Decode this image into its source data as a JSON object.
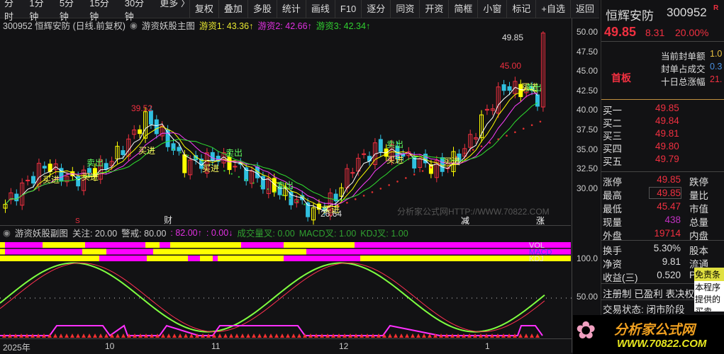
{
  "toolbar": {
    "left": [
      "分时",
      "1分钟",
      "5分钟",
      "15分钟",
      "30分钟",
      "更多 〉"
    ],
    "right": [
      "复权",
      "叠加",
      "多股",
      "统计",
      "画线",
      "F10",
      "逐分",
      "同资",
      "开资",
      "简框",
      "小窗",
      "标记",
      "+自选",
      "返回"
    ]
  },
  "infobar": {
    "code_name": "300952 恒辉安防 (日线.前复权)",
    "indicator": "游资妖股主图",
    "v1": "游资1: 43.36↑",
    "v2": "游资2: 42.66↑",
    "v3": "游资3: 42.34↑"
  },
  "main_labels": {
    "high1": "39.52",
    "high2": "45.00",
    "last": "49.85",
    "low": "26.64",
    "watermark": "分析家公式网HTTP://WWW.70822.COM",
    "buy": "买进",
    "sell": "卖出",
    "tag_s": "S",
    "tag_cai": "财",
    "tag_jian": "减",
    "tag_zhang": "涨"
  },
  "price_axis": [
    "50.00",
    "47.50",
    "45.00",
    "42.50",
    "40.00",
    "37.50",
    "35.00",
    "32.50",
    "30.00"
  ],
  "sub": {
    "title": "游资妖股副图",
    "focus": "关注: 20.00",
    "warn": "警戒: 80.00",
    "v1": ": 82.00↑",
    "v2": ": 0.00↓",
    "vol": "成交量叉: 0.00",
    "macd": "MACD叉: 1.00",
    "kdj": "KDJ叉: 1.00",
    "band_labels": [
      "VOL",
      "MACD",
      "KDJ"
    ],
    "axis": [
      "100.0",
      "50.00"
    ]
  },
  "xaxis": [
    "2025年",
    "10",
    "11",
    "12",
    "1"
  ],
  "colors": {
    "up": "#f03040",
    "down": "#30c0e0",
    "yellow": "#ffff00",
    "magenta": "#ff00ff"
  },
  "panel": {
    "name": "恒辉安防",
    "code": "300952",
    "flag": "R",
    "price": "49.85",
    "change": "8.31",
    "pct": "20.00%",
    "board": "首板",
    "seal": [
      {
        "k": "当前封单额",
        "v": "1.0"
      },
      {
        "k": "封单占成交",
        "v": "0.3"
      },
      {
        "k": "十日总涨幅",
        "v": "21."
      }
    ],
    "bids": [
      {
        "k": "买一",
        "v": "49.85"
      },
      {
        "k": "买二",
        "v": "49.84"
      },
      {
        "k": "买三",
        "v": "49.81"
      },
      {
        "k": "买四",
        "v": "49.80"
      },
      {
        "k": "买五",
        "v": "49.79"
      }
    ],
    "stats": [
      {
        "k": "涨停",
        "v": "49.85",
        "k2": "跌停"
      },
      {
        "k": "最高",
        "v": "49.85",
        "k2": "量比"
      },
      {
        "k": "最低",
        "v": "45.47",
        "k2": "市值"
      },
      {
        "k": "现量",
        "v": "438",
        "k2": "总量"
      },
      {
        "k": "外盘",
        "v": "19714",
        "k2": "内盘"
      }
    ],
    "stats2": [
      {
        "k": "换手",
        "v": "5.30%",
        "k2": "股本"
      },
      {
        "k": "净资",
        "v": "9.81",
        "k2": "流通"
      },
      {
        "k": "收益(三)",
        "v": "0.520",
        "k2": "P"
      }
    ],
    "tags": "注册制 已盈利 表决权",
    "status": "交易状态: 闭市阶段",
    "tooltip": [
      "免责条",
      "本程序",
      "提供的",
      "买卖"
    ],
    "logo": "分析家公式网",
    "logo_url": "WWW.70822.COM"
  },
  "chart_data": {
    "type": "candlestick",
    "close_anchors": [
      [
        0,
        28
      ],
      [
        7,
        33
      ],
      [
        12,
        31
      ],
      [
        18,
        33
      ],
      [
        22,
        36
      ],
      [
        25,
        39
      ],
      [
        28,
        37
      ],
      [
        32,
        33
      ],
      [
        38,
        34
      ],
      [
        43,
        32
      ],
      [
        48,
        30
      ],
      [
        53,
        28
      ],
      [
        55,
        26.8
      ],
      [
        59,
        29
      ],
      [
        62,
        33
      ],
      [
        66,
        35
      ],
      [
        70,
        34.5
      ],
      [
        75,
        33
      ],
      [
        78,
        32.5
      ],
      [
        82,
        35
      ],
      [
        86,
        40
      ],
      [
        89,
        43
      ],
      [
        93,
        42.5
      ],
      [
        95,
        41.5
      ],
      [
        96,
        49.85
      ]
    ],
    "ylim": [
      26,
      50
    ]
  }
}
